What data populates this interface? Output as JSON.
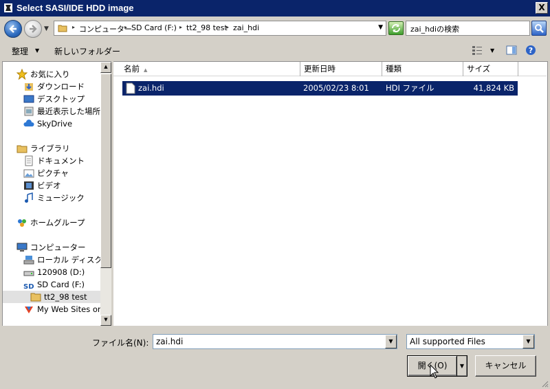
{
  "window": {
    "title": "Select SASI/IDE HDD image",
    "close_label": "X"
  },
  "nav": {
    "breadcrumbs": [
      "コンピューター",
      "SD Card (F:)",
      "tt2_98 test",
      "zai_hdi"
    ],
    "search_placeholder": "zai_hdiの検索"
  },
  "toolbar": {
    "organize_label": "整理",
    "new_folder_label": "新しいフォルダー"
  },
  "sidebar": {
    "favorites": [
      {
        "label": "お気に入り",
        "icon": "star-icon"
      },
      {
        "label": "ダウンロード",
        "icon": "downloads-icon"
      },
      {
        "label": "デスクトップ",
        "icon": "desktop-icon"
      },
      {
        "label": "最近表示した場所",
        "icon": "recent-places-icon"
      },
      {
        "label": "SkyDrive",
        "icon": "skydrive-icon"
      }
    ],
    "libraries": [
      {
        "label": "ライブラリ",
        "icon": "library-icon"
      },
      {
        "label": "ドキュメント",
        "icon": "documents-icon"
      },
      {
        "label": "ピクチャ",
        "icon": "pictures-icon"
      },
      {
        "label": "ビデオ",
        "icon": "videos-icon"
      },
      {
        "label": "ミュージック",
        "icon": "music-icon"
      }
    ],
    "homegroup": {
      "label": "ホームグループ",
      "icon": "homegroup-icon"
    },
    "computer": [
      {
        "label": "コンピューター",
        "icon": "computer-icon"
      },
      {
        "label": "ローカル ディスク (C",
        "icon": "local-disk-icon"
      },
      {
        "label": "120908 (D:)",
        "icon": "drive-icon"
      },
      {
        "label": "SD Card (F:)",
        "icon": "sd-card-icon"
      },
      {
        "label": "tt2_98 test",
        "icon": "folder-icon"
      },
      {
        "label": "My Web Sites on",
        "icon": "web-sites-icon"
      }
    ]
  },
  "file_list": {
    "columns": [
      "名前",
      "更新日時",
      "種類",
      "サイズ"
    ],
    "rows": [
      {
        "name": "zai.hdi",
        "modified": "2005/02/23 8:01",
        "type": "HDI ファイル",
        "size": "41,824 KB"
      }
    ]
  },
  "footer": {
    "filename_label": "ファイル名(N):",
    "filename_value": "zai.hdi",
    "filter_value": "All supported Files",
    "open_label": "開く(O)",
    "cancel_label": "キャンセル"
  },
  "colors": {
    "titlebar": "#0a246a",
    "selection": "#0a246a",
    "face": "#d4d0c8"
  }
}
